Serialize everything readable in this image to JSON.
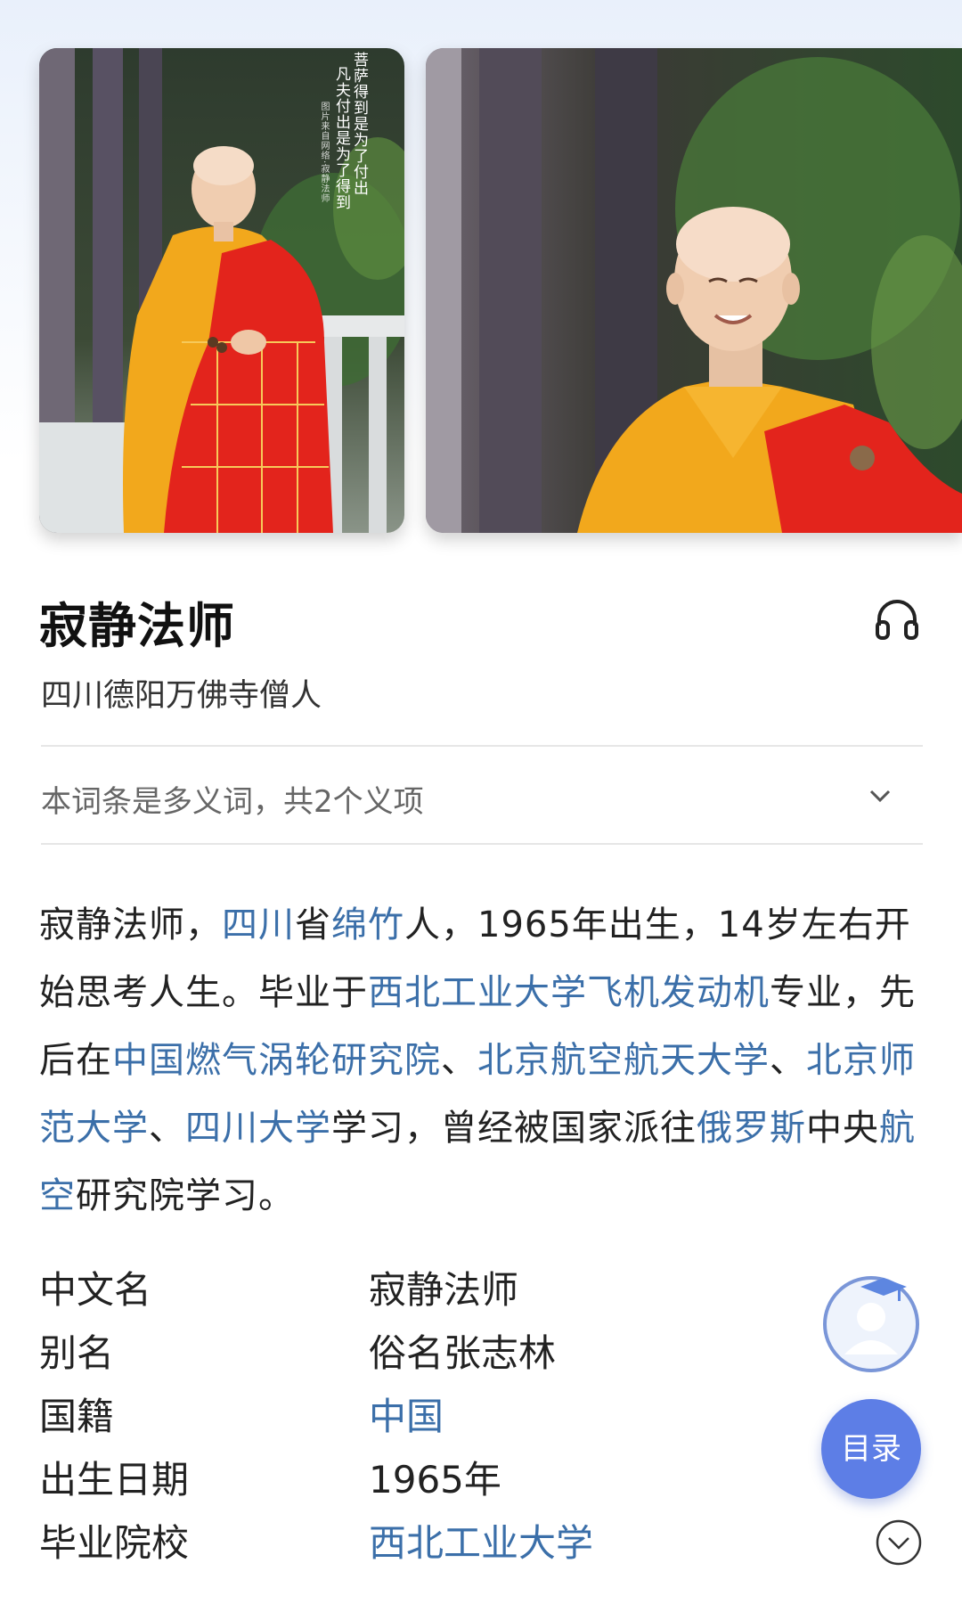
{
  "photo1": {
    "caption_line1": "菩萨得到是为了付出",
    "caption_line2": "凡夫付出是为了得到",
    "small_caption": "图片来自网络·寂静法师"
  },
  "entry": {
    "title": "寂静法师",
    "subtitle": "四川德阳万佛寺僧人",
    "polysemy_note": "本词条是多义词，共2个义项"
  },
  "summary": {
    "t1": "寂静法师，",
    "l1": "四川",
    "t2": "省",
    "l2": "绵竹",
    "t3": "人，1965年出生，14岁左右开始思考人生。毕业于",
    "l3": "西北工业大学飞机发动机",
    "t4": "专业，先后在",
    "l4": "中国燃气涡轮研究院",
    "t5": "、",
    "l5": "北京航空航天大学",
    "t6": "、",
    "l6": "北京师范大学",
    "t7": "、",
    "l7": "四川大学",
    "t8": "学习，曾经被国家派往",
    "l8": "俄罗斯",
    "t9": "中央",
    "l9": "航空",
    "t10": "研究院学习。"
  },
  "info": [
    {
      "label": "中文名",
      "value": "寂静法师",
      "link": false
    },
    {
      "label": "别名",
      "value": "俗名张志林",
      "link": false
    },
    {
      "label": "国籍",
      "value": "中国",
      "link": true
    },
    {
      "label": "出生日期",
      "value": "1965年",
      "link": false
    },
    {
      "label": "毕业院校",
      "value": "西北工业大学",
      "link": true
    }
  ],
  "floating": {
    "toc_label": "目录"
  },
  "icons": {
    "headphone": "headphone-icon",
    "chevron": "chevron-down-icon",
    "avatar": "avatar-icon",
    "scroll_down": "chevron-down-circle-icon"
  },
  "colors": {
    "link": "#3b6fa9",
    "toc_button": "#5d7ee6",
    "robe_red": "#e3241c",
    "robe_yellow": "#f2a81c"
  }
}
